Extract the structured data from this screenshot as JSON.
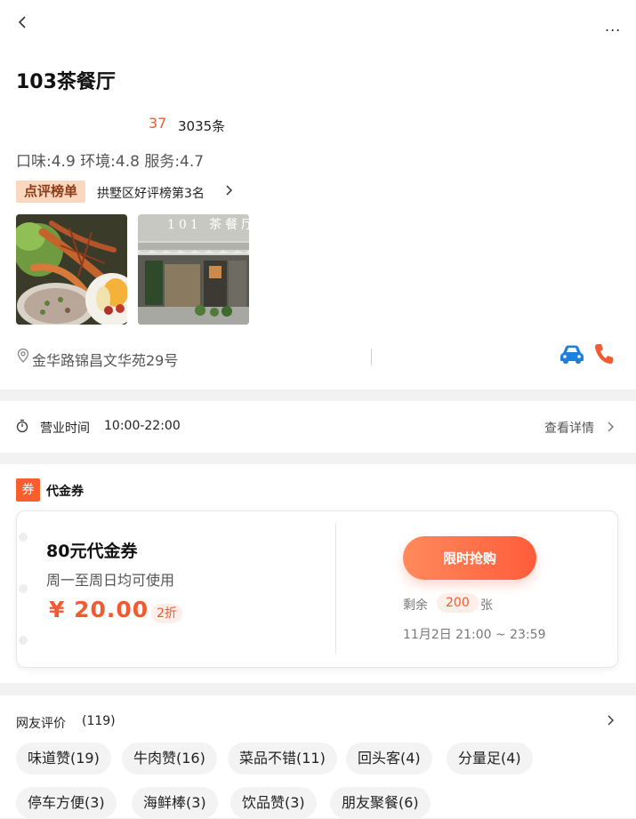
{
  "header": {
    "back_icon": "chevron-left-icon",
    "more_label": "...",
    "title": "103茶餐厅",
    "score": "37",
    "review_count": "3035条",
    "ratings": "口味:4.9 环境:4.8 服务:4.7",
    "rank_badge": "点评榜单",
    "rank_text": "拱墅区好评榜第3名",
    "store_sign": "101 茶餐厅",
    "address": "金华路锦昌文华苑29号",
    "car_icon": "car-icon",
    "phone_icon": "phone-icon",
    "accent": "#f25b32"
  },
  "hours": {
    "label": "营业时间",
    "value": "10:00-22:00",
    "details": "查看详情"
  },
  "voucher": {
    "badge": "券",
    "section_title": "代金券",
    "name": "80元代金券",
    "desc": "周一至周日均可使用",
    "price": "¥ 20.00",
    "discount": "2折",
    "buy_label": "限时抢购",
    "remain_prefix": "剩余",
    "remain_count": "200",
    "remain_suffix": "张",
    "validity": "11月2日 21:00 ~ 23:59"
  },
  "reviews": {
    "title": "网友评价",
    "count": "(119)",
    "tags": [
      "味道赞(19)",
      "牛肉赞(16)",
      "菜品不错(11)",
      "回头客(4)",
      "分量足(4)",
      "停车方便(3)",
      "海鲜棒(3)",
      "饮品赞(3)",
      "朋友聚餐(6)"
    ]
  }
}
